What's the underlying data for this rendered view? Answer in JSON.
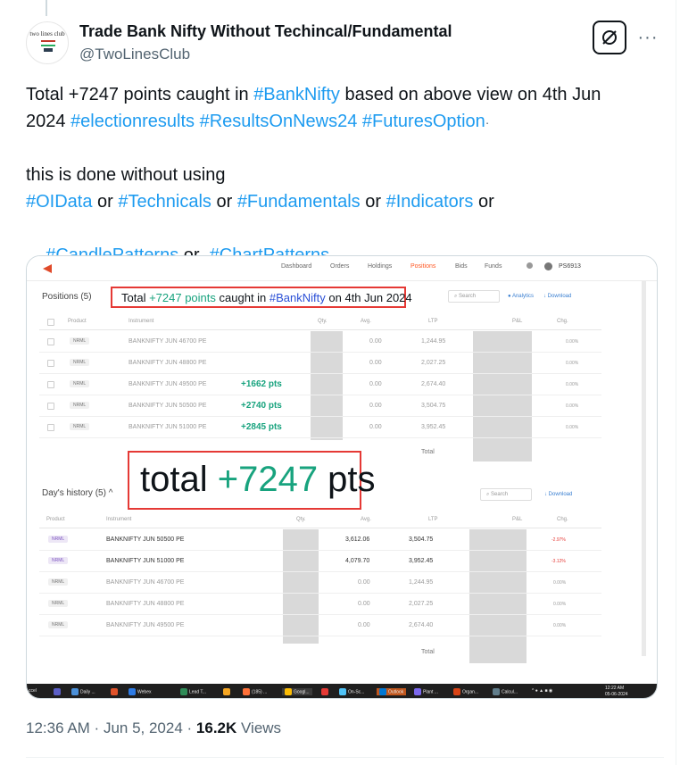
{
  "tweet": {
    "author_name": "Trade Bank Nifty Without Techincal/Fundamental",
    "author_handle": "@TwoLinesClub",
    "avatar_text": "two lines club",
    "line1_a": "Total +7247 points caught in ",
    "line1_tag": "#BankNifty",
    "line1_b": " based on above view on 4th Jun",
    "line2_a": "2024 ",
    "line2_tags": [
      "#electionresults",
      "#ResultsOnNews24",
      "#FuturesOption"
    ],
    "line3": "this is done without using",
    "line4": [
      {
        "tag": "#OIData",
        "after": " or "
      },
      {
        "tag": "#Technicals",
        "after": " or "
      },
      {
        "tag": "#Fundamentals",
        "after": " or "
      },
      {
        "tag": "#Indicators",
        "after": " or"
      }
    ],
    "line5": [
      {
        "tag": "#CandlePatterns",
        "after": " or  "
      },
      {
        "tag": "#ChartPatterns",
        "after": ""
      }
    ],
    "time": "12:36 AM",
    "date": "Jun 5, 2024",
    "views_count": "16.2K",
    "views_label": "Views",
    "more_label": "···"
  },
  "screenshot": {
    "nav": [
      "Dashboard",
      "Orders",
      "Holdings",
      "Positions",
      "Bids",
      "Funds"
    ],
    "active_nav": "Positions",
    "user_id": "PS6913",
    "positions_title": "Positions (5)",
    "annotation_small": {
      "a": "Total ",
      "b": "+7247 points",
      "c": " caught in ",
      "d": "#BankNifty",
      "e": " on 4th Jun 2024"
    },
    "search_placeholder": "Search",
    "analytics_label": "Analytics",
    "download_label": "Download",
    "positions_headers": [
      "Product",
      "Instrument",
      "Qty.",
      "Avg.",
      "LTP",
      "P&L",
      "Chg."
    ],
    "positions_rows": [
      {
        "product": "NRML",
        "instrument": "BANKNIFTY JUN 46700 PE",
        "exch": "NFO",
        "avg": "0.00",
        "ltp": "1,244.95",
        "chg": "0.00%",
        "pts": ""
      },
      {
        "product": "NRML",
        "instrument": "BANKNIFTY JUN 48800 PE",
        "exch": "NFO",
        "avg": "0.00",
        "ltp": "2,027.25",
        "chg": "0.00%",
        "pts": ""
      },
      {
        "product": "NRML",
        "instrument": "BANKNIFTY JUN 49500 PE",
        "exch": "NFO",
        "avg": "0.00",
        "ltp": "2,674.40",
        "chg": "0.00%",
        "pts": "+1662 pts"
      },
      {
        "product": "NRML",
        "instrument": "BANKNIFTY JUN 50500 PE",
        "exch": "NFO",
        "avg": "0.00",
        "ltp": "3,504.75",
        "chg": "0.00%",
        "pts": "+2740 pts"
      },
      {
        "product": "NRML",
        "instrument": "BANKNIFTY JUN 51000 PE",
        "exch": "NFO",
        "avg": "0.00",
        "ltp": "3,952.45",
        "chg": "0.00%",
        "pts": "+2845 pts"
      }
    ],
    "total_label": "Total",
    "annotation_big": {
      "a": "total ",
      "b": "+7247",
      "c": " pts"
    },
    "history_title": "Day's history (5)",
    "history_headers": [
      "Product",
      "Instrument",
      "Qty.",
      "Avg.",
      "LTP",
      "P&L",
      "Chg."
    ],
    "history_rows": [
      {
        "product": "NRML",
        "instrument": "BANKNIFTY JUN 50500 PE",
        "exch": "NFO",
        "avg": "3,612.06",
        "ltp": "3,504.75",
        "chg": "-2.97%",
        "active": true
      },
      {
        "product": "NRML",
        "instrument": "BANKNIFTY JUN 51000 PE",
        "exch": "NFO",
        "avg": "4,079.70",
        "ltp": "3,952.45",
        "chg": "-3.12%",
        "active": true
      },
      {
        "product": "NRML",
        "instrument": "BANKNIFTY JUN 46700 PE",
        "exch": "NFO",
        "avg": "0.00",
        "ltp": "1,244.95",
        "chg": "0.00%",
        "active": false
      },
      {
        "product": "NRML",
        "instrument": "BANKNIFTY JUN 48800 PE",
        "exch": "NFO",
        "avg": "0.00",
        "ltp": "2,027.25",
        "chg": "0.00%",
        "active": false
      },
      {
        "product": "NRML",
        "instrument": "BANKNIFTY JUN 49500 PE",
        "exch": "NFO",
        "avg": "0.00",
        "ltp": "2,674.40",
        "chg": "0.00%",
        "active": false
      }
    ],
    "taskbar": [
      "Daily ...",
      "Webex",
      "Lead T...",
      "(185) ...",
      "Googl...",
      "On-Sc...",
      "Outlook",
      "Plant ...",
      "Organ...",
      "Calcul..."
    ],
    "taskbar_first": "ccel",
    "clock_time": "12:22 AM",
    "clock_date": "05-06-2024"
  },
  "colors": {
    "link": "#1d9bf0",
    "green": "#18a37e",
    "annotation_red": "#e53935",
    "kite_orange": "#ff5722"
  }
}
